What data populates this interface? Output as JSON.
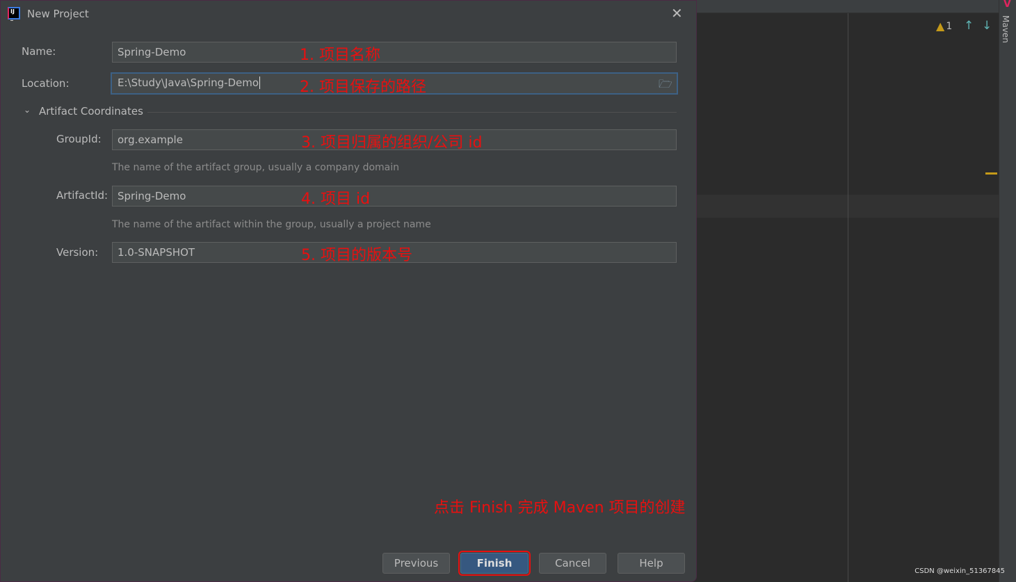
{
  "window": {
    "title": "New Project",
    "close_icon": "close-icon"
  },
  "form": {
    "name": {
      "label": "Name:",
      "value": "Spring-Demo",
      "annotation": "1. 项目名称"
    },
    "location": {
      "label": "Location:",
      "value": "E:\\Study\\Java\\Spring-Demo",
      "annotation": "2. 项目保存的路径",
      "browse_icon": "folder-icon"
    },
    "artifact_section": {
      "title": "Artifact Coordinates",
      "expanded": true
    },
    "group_id": {
      "label": "GroupId:",
      "value": "org.example",
      "annotation": "3. 项目归属的组织/公司 id",
      "hint": "The name of the artifact group, usually a company domain"
    },
    "artifact_id": {
      "label": "ArtifactId:",
      "value": "Spring-Demo",
      "annotation": "4. 项目 id",
      "hint": "The name of the artifact within the group, usually a project name"
    },
    "version": {
      "label": "Version:",
      "value": "1.0-SNAPSHOT",
      "annotation": "5. 项目的版本号"
    }
  },
  "final_annotation": "点击 Finish 完成 Maven 项目的创建",
  "buttons": {
    "previous": "Previous",
    "finish": "Finish",
    "cancel": "Cancel",
    "help": "Help"
  },
  "ide": {
    "warning_count": "1",
    "maven_tab": "Maven",
    "watermark": "CSDN @weixin_51367845"
  },
  "colors": {
    "annotation": "#e81010",
    "primary_button": "#365880",
    "warning": "#c59a19"
  }
}
